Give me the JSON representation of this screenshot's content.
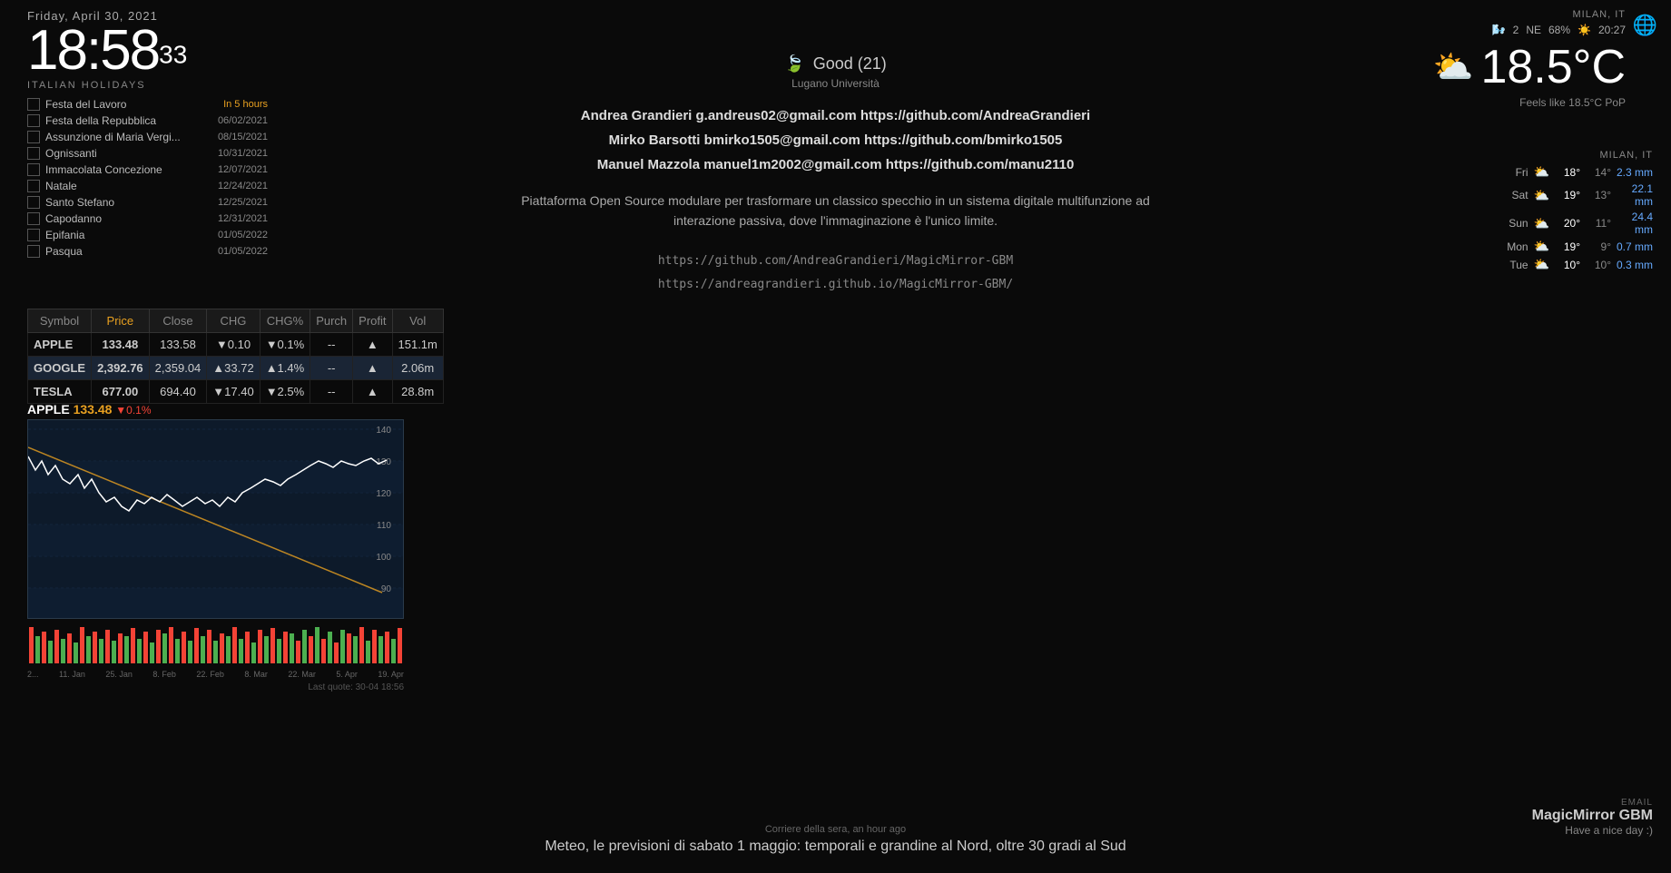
{
  "clock": {
    "date": "Friday, April 30, 2021",
    "hours": "18:58",
    "seconds": "33"
  },
  "holidays": {
    "title": "ITALIAN HOLIDAYS",
    "items": [
      {
        "name": "Festa del Lavoro",
        "date": "In 5 hours",
        "soon": true
      },
      {
        "name": "Festa della Repubblica",
        "date": "06/02/2021",
        "soon": false
      },
      {
        "name": "Assunzione di Maria Vergi...",
        "date": "08/15/2021",
        "soon": false
      },
      {
        "name": "Ognissanti",
        "date": "10/31/2021",
        "soon": false
      },
      {
        "name": "Immacolata Concezione",
        "date": "12/07/2021",
        "soon": false
      },
      {
        "name": "Natale",
        "date": "12/24/2021",
        "soon": false
      },
      {
        "name": "Santo Stefano",
        "date": "12/25/2021",
        "soon": false
      },
      {
        "name": "Capodanno",
        "date": "12/31/2021",
        "soon": false
      },
      {
        "name": "Epifania",
        "date": "01/05/2022",
        "soon": false
      },
      {
        "name": "Pasqua",
        "date": "01/05/2022",
        "soon": false
      }
    ]
  },
  "air_quality": {
    "status": "Good (21)",
    "location": "Lugano Università"
  },
  "contributors": [
    {
      "name": "Andrea Grandieri",
      "email": "g.andreus02@gmail.com",
      "github": "https://github.com/AndreaGrandieri"
    },
    {
      "name": "Mirko Barsotti",
      "email": "bmirko1505@gmail.com",
      "github": "https://github.com/bmirko1505"
    },
    {
      "name": "Manuel Mazzola",
      "email": "manuel1m2002@gmail.com",
      "github": "https://github.com/manu2110"
    }
  ],
  "description": "Piattaforma Open Source modulare per trasformare un classico specchio in un sistema digitale multifunzione ad interazione passiva, dove l'immaginazione è l'unico limite.",
  "links": [
    "https://github.com/AndreaGrandieri/MagicMirror-GBM",
    "https://andreagrandieri.github.io/MagicMirror-GBM/"
  ],
  "stocks": {
    "headers": [
      "Symbol",
      "Price",
      "Close",
      "CHG",
      "CHG%",
      "Purch",
      "Profit",
      "Vol"
    ],
    "rows": [
      {
        "symbol": "APPLE",
        "price": "133.48",
        "close": "133.58",
        "chg": "0.10",
        "chg_pct": "0.1%",
        "purch": "--",
        "profit": "▲",
        "vol": "151.1m",
        "price_dir": "down",
        "chg_dir": "down",
        "highlighted": false
      },
      {
        "symbol": "GOOGLE",
        "price": "2,392.76",
        "close": "2,359.04",
        "chg": "33.72",
        "chg_pct": "1.4%",
        "purch": "--",
        "profit": "▲",
        "vol": "2.06m",
        "price_dir": "up",
        "chg_dir": "up",
        "highlighted": true
      },
      {
        "symbol": "TESLA",
        "price": "677.00",
        "close": "694.40",
        "chg": "17.40",
        "chg_pct": "2.5%",
        "purch": "--",
        "profit": "▲",
        "vol": "28.8m",
        "price_dir": "neutral",
        "chg_dir": "down",
        "highlighted": false
      }
    ]
  },
  "chart": {
    "ticker": "APPLE",
    "price": "133.48",
    "change": "▼0.1%",
    "last_quote": "Last quote: 30-04 18:56",
    "y_labels": [
      "140",
      "130",
      "120",
      "110",
      "100",
      "90"
    ],
    "x_labels": [
      "2...",
      "11. Jan",
      "25. Jan",
      "8. Feb",
      "22. Feb",
      "8. Mar",
      "22. Mar",
      "5. Apr",
      "19. Apr"
    ]
  },
  "weather": {
    "location": "MILAN, IT",
    "wind_dir": "NE",
    "wind_speed": "2",
    "humidity": "68%",
    "time": "20:27",
    "temperature": "18.5°C",
    "feels_like": "Feels like 18.5°C PoP",
    "forecast_location": "MILAN, IT",
    "forecast": [
      {
        "day": "Fri",
        "icon": "cloud",
        "high": "18°",
        "low": "14°",
        "rain": "2.3 mm"
      },
      {
        "day": "Sat",
        "icon": "cloud",
        "high": "19°",
        "low": "13°",
        "rain": "22.1 mm"
      },
      {
        "day": "Sun",
        "icon": "cloud",
        "high": "20°",
        "low": "11°",
        "rain": "24.4 mm"
      },
      {
        "day": "Mon",
        "icon": "cloud",
        "high": "19°",
        "low": "9°",
        "rain": "0.7 mm"
      },
      {
        "day": "Tue",
        "icon": "cloud",
        "high": "10°",
        "low": "10°",
        "rain": "0.3 mm"
      }
    ]
  },
  "email": {
    "label": "EMAIL",
    "title": "MagicMirror GBM",
    "subtitle": "Have a nice day :)"
  },
  "news": {
    "source": "Corriere della sera, an hour ago",
    "headline": "Meteo, le previsioni di sabato 1 maggio: temporali e grandine al Nord, oltre 30 gradi al Sud"
  }
}
